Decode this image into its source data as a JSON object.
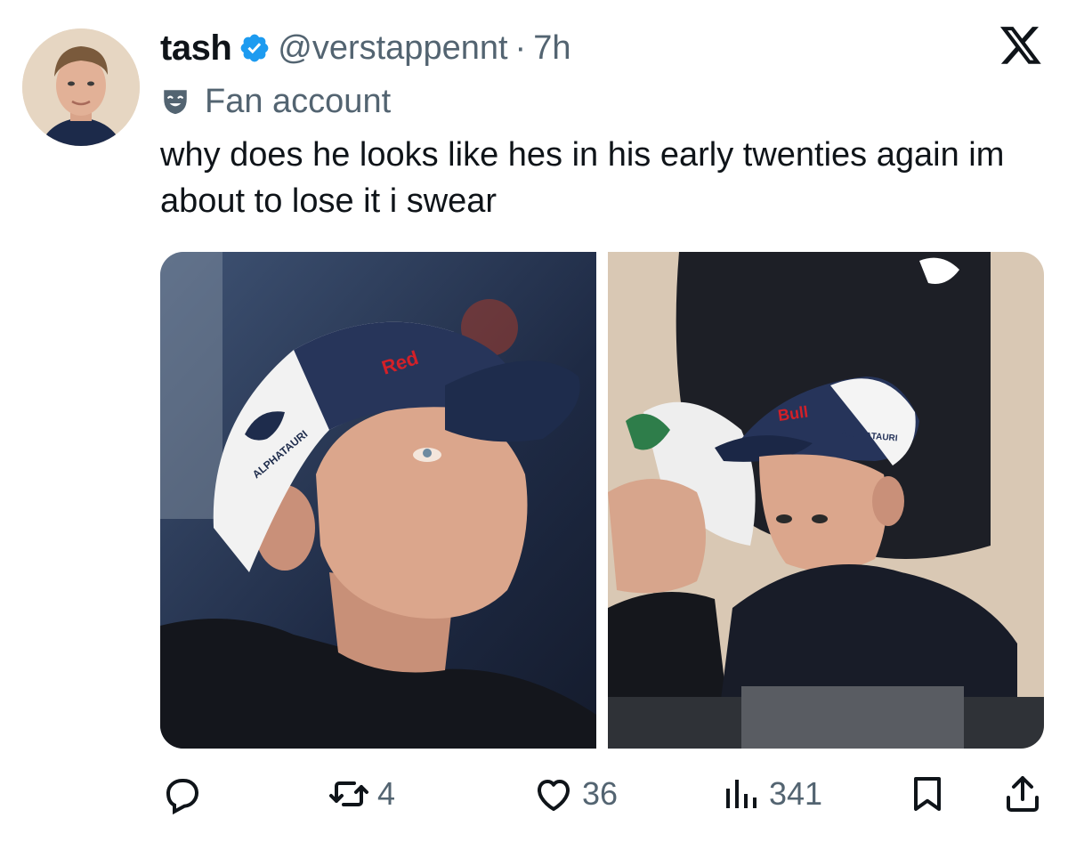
{
  "tweet": {
    "author": {
      "display_name": "tash",
      "handle": "@verstappennt",
      "verified": true,
      "avatar_icon": "profile-photo"
    },
    "separator": "·",
    "time": "7h",
    "account_label": {
      "icon": "theater-mask-icon",
      "text": "Fan account"
    },
    "text": "why does he looks like hes in his early twenties again im about to lose it i swear",
    "media": [
      {
        "kind": "photo",
        "description_icon": "photo-left",
        "cap_texts": [
          "Red",
          "ALPHATAURI"
        ]
      },
      {
        "kind": "photo",
        "description_icon": "photo-right",
        "cap_texts": [
          "Bull",
          "ALPHATAURI"
        ]
      }
    ],
    "actions": {
      "reply": {
        "icon": "reply-icon",
        "count": ""
      },
      "retweet": {
        "icon": "retweet-icon",
        "count": "4"
      },
      "like": {
        "icon": "heart-icon",
        "count": "36"
      },
      "views": {
        "icon": "views-icon",
        "count": "341"
      },
      "bookmark": {
        "icon": "bookmark-icon"
      },
      "share": {
        "icon": "share-icon"
      }
    }
  },
  "colors": {
    "text": "#0f1419",
    "secondary": "#536471",
    "verified_blue": "#1d9bf0"
  }
}
